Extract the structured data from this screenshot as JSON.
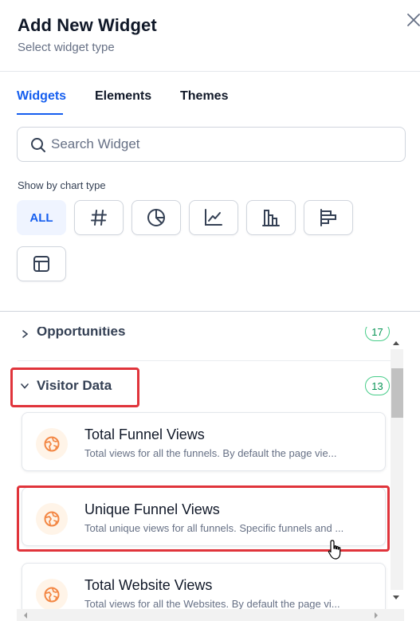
{
  "header": {
    "title": "Add New Widget",
    "subtitle": "Select widget type"
  },
  "tabs": [
    {
      "label": "Widgets",
      "active": true
    },
    {
      "label": "Elements",
      "active": false
    },
    {
      "label": "Themes",
      "active": false
    }
  ],
  "search": {
    "placeholder": "Search Widget",
    "value": ""
  },
  "chart_type": {
    "label": "Show by chart type",
    "all_label": "ALL",
    "options": [
      "all",
      "number-icon",
      "pie-chart-icon",
      "line-chart-icon",
      "bar-chart-icon",
      "horizontal-bar-chart-icon",
      "table-icon"
    ],
    "selected": "all"
  },
  "groups": [
    {
      "title": "Opportunities",
      "count": "17",
      "expanded": false
    },
    {
      "title": "Visitor Data",
      "count": "13",
      "expanded": true
    }
  ],
  "widgets": [
    {
      "title": "Total Funnel Views",
      "description": "Total views for all the funnels. By default the page vie..."
    },
    {
      "title": "Unique Funnel Views",
      "description": "Total unique views for all funnels. Specific funnels and ..."
    },
    {
      "title": "Total Website Views",
      "description": "Total views for all the Websites. By default the page vi..."
    }
  ],
  "colors": {
    "accent": "#155eef",
    "highlight": "#e0343b",
    "badge_green": "#079455",
    "icon_orange": "#f38744"
  }
}
